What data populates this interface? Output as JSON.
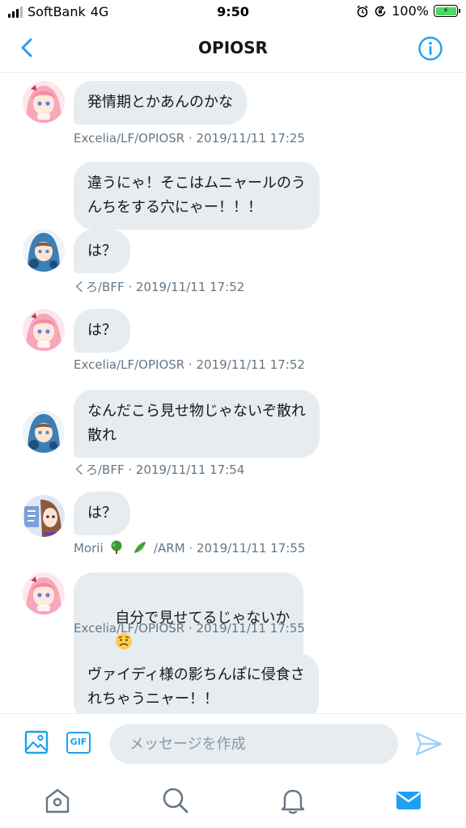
{
  "status_bar": {
    "carrier": "SoftBank",
    "network": "4G",
    "time": "9:50",
    "battery_percent": "100%",
    "icons": [
      "signal-icon",
      "alarm-icon",
      "orientation-lock-icon",
      "battery-charging-icon"
    ]
  },
  "header": {
    "title": "OPIOSR",
    "back_icon": "chevron-left-icon",
    "info_icon": "info-icon"
  },
  "colors": {
    "accent": "#1da1f2",
    "bubble": "#e6ecf0",
    "meta_text": "#657786",
    "placeholder": "#8899a6"
  },
  "messages": [
    {
      "avatar": "excelia-avatar",
      "text": "発情期とかあんのかな",
      "meta": "Excelia/LF/OPIOSR · 2019/11/11 17:25"
    },
    {
      "avatar": "",
      "text": "違うにゃ！そこはムニャールのう\nんちをする穴にゃー！！！",
      "meta": ""
    },
    {
      "avatar": "kuro-avatar",
      "text": "は？",
      "meta": "くろ/BFF · 2019/11/11 17:52"
    },
    {
      "avatar": "excelia-avatar",
      "text": "は？",
      "meta": "Excelia/LF/OPIOSR · 2019/11/11 17:52"
    },
    {
      "avatar": "kuro-avatar",
      "text": "なんだこら見せ物じゃないぞ散れ\n散れ",
      "meta": "くろ/BFF · 2019/11/11 17:54"
    },
    {
      "avatar": "morii-avatar",
      "text": "は？",
      "meta_name": "Morii",
      "meta_suffix": "/ARM",
      "meta_time": "· 2019/11/11 17:55"
    },
    {
      "avatar": "excelia-avatar",
      "text": "自分で見せてるじゃないか",
      "meta": "Excelia/LF/OPIOSR · 2019/11/11 17:55"
    },
    {
      "avatar": "",
      "text": "ヴァイディ様の影ちんぽに侵食さ\nれちゃうニャー！！",
      "meta": ""
    }
  ],
  "composer": {
    "media_icon": "image-icon",
    "gif_label": "GIF",
    "placeholder": "メッセージを作成",
    "send_icon": "send-icon"
  },
  "tab_bar": {
    "tabs": [
      "home-icon",
      "search-icon",
      "notifications-icon",
      "messages-icon"
    ],
    "active": "messages-icon"
  }
}
